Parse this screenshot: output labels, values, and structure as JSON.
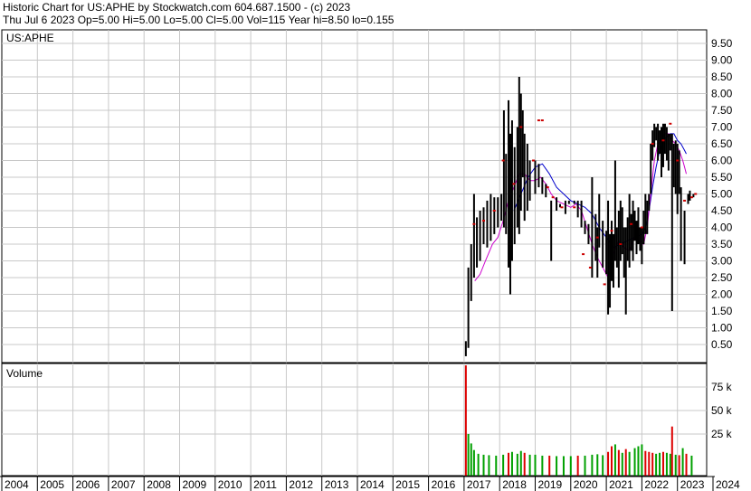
{
  "header": {
    "line1": "Historic Chart for US:APHE by Stockwatch.com 604.687.1500 - (c) 2023",
    "line2": "Thu Jul  6 2023   Op=5.00  Hi=5.00  Lo=5.00  Cl=5.00  Vol=115   Year hi=8.50   lo=0.155"
  },
  "colors": {
    "background": "#ffffff",
    "grid": "#c8c8c8",
    "price_bars": "#000000",
    "price_marks": "#cc0000",
    "ma_short": "#cc00cc",
    "ma_long": "#0000cc",
    "volume_green": "#00a000",
    "volume_red": "#dd0000"
  },
  "chart_data": [
    {
      "type": "ohlc",
      "title": "US:APHE",
      "x_range": [
        2004,
        2024
      ],
      "ylim": [
        0,
        10
      ],
      "y_ticks": [
        "9.50",
        "9.00",
        "8.50",
        "8.00",
        "7.50",
        "7.00",
        "6.50",
        "6.00",
        "5.50",
        "5.00",
        "4.50",
        "4.00",
        "3.50",
        "3.00",
        "2.50",
        "2.00",
        "1.50",
        "1.00",
        "0.50"
      ],
      "y_tick_values": [
        9.5,
        9.0,
        8.5,
        8.0,
        7.5,
        7.0,
        6.5,
        6.0,
        5.5,
        5.0,
        4.5,
        4.0,
        3.5,
        3.0,
        2.5,
        2.0,
        1.5,
        1.0,
        0.5
      ],
      "grid": true,
      "price_range_bars": [
        [
          2017.05,
          0.15,
          0.6
        ],
        [
          2017.12,
          0.4,
          2.8
        ],
        [
          2017.2,
          1.8,
          3.5
        ],
        [
          2017.28,
          2.5,
          5.0
        ],
        [
          2017.36,
          2.8,
          4.3
        ],
        [
          2017.45,
          3.0,
          4.5
        ],
        [
          2017.55,
          3.5,
          4.6
        ],
        [
          2017.65,
          3.4,
          4.8
        ],
        [
          2017.75,
          3.6,
          5.0
        ],
        [
          2017.85,
          3.8,
          4.9
        ],
        [
          2017.95,
          4.0,
          4.9
        ],
        [
          2018.05,
          4.2,
          5.0
        ],
        [
          2018.12,
          4.0,
          7.5
        ],
        [
          2018.18,
          3.8,
          6.2
        ],
        [
          2018.25,
          2.8,
          7.8
        ],
        [
          2018.3,
          2.0,
          6.8
        ],
        [
          2018.35,
          3.0,
          7.2
        ],
        [
          2018.42,
          3.5,
          6.4
        ],
        [
          2018.5,
          4.0,
          7.0
        ],
        [
          2018.55,
          3.8,
          8.5
        ],
        [
          2018.6,
          4.5,
          8.0
        ],
        [
          2018.65,
          5.5,
          7.5
        ],
        [
          2018.7,
          4.2,
          6.8
        ],
        [
          2018.78,
          4.5,
          6.5
        ],
        [
          2018.85,
          4.8,
          6.0
        ],
        [
          2019.0,
          5.0,
          6.0
        ],
        [
          2019.1,
          5.2,
          5.9
        ],
        [
          2019.2,
          5.0,
          5.5
        ],
        [
          2019.3,
          4.9,
          5.3
        ],
        [
          2019.45,
          3.0,
          4.8
        ],
        [
          2019.6,
          4.5,
          4.9
        ],
        [
          2019.7,
          4.6,
          4.7
        ],
        [
          2019.85,
          4.4,
          4.8
        ],
        [
          2019.95,
          4.7,
          4.8
        ],
        [
          2020.1,
          4.7,
          4.8
        ],
        [
          2020.2,
          4.3,
          4.8
        ],
        [
          2020.3,
          4.0,
          4.8
        ],
        [
          2020.4,
          3.8,
          4.2
        ],
        [
          2020.5,
          3.5,
          4.1
        ],
        [
          2020.6,
          2.5,
          5.5
        ],
        [
          2020.7,
          3.0,
          4.4
        ],
        [
          2020.75,
          2.5,
          4.0
        ],
        [
          2020.8,
          3.4,
          5.0
        ],
        [
          2020.9,
          2.8,
          4.2
        ],
        [
          2021.0,
          2.6,
          3.9
        ],
        [
          2021.05,
          1.4,
          4.8
        ],
        [
          2021.1,
          1.6,
          3.8
        ],
        [
          2021.15,
          2.4,
          4.2
        ],
        [
          2021.2,
          2.2,
          3.8
        ],
        [
          2021.25,
          3.0,
          6.0
        ],
        [
          2021.3,
          2.8,
          4.0
        ],
        [
          2021.35,
          2.2,
          4.5
        ],
        [
          2021.4,
          3.0,
          4.8
        ],
        [
          2021.45,
          3.2,
          4.6
        ],
        [
          2021.5,
          2.5,
          4.0
        ],
        [
          2021.55,
          1.4,
          4.0
        ],
        [
          2021.6,
          3.0,
          4.3
        ],
        [
          2021.65,
          2.8,
          5.0
        ],
        [
          2021.7,
          3.3,
          4.4
        ],
        [
          2021.75,
          3.0,
          4.8
        ],
        [
          2021.8,
          3.6,
          4.5
        ],
        [
          2021.85,
          3.2,
          4.2
        ],
        [
          2021.9,
          3.5,
          4.6
        ],
        [
          2021.95,
          3.3,
          4.0
        ],
        [
          2022.0,
          2.9,
          4.0
        ],
        [
          2022.05,
          3.5,
          4.5
        ],
        [
          2022.1,
          3.8,
          5.0
        ],
        [
          2022.15,
          3.8,
          4.8
        ],
        [
          2022.2,
          4.5,
          5.0
        ],
        [
          2022.25,
          5.0,
          6.5
        ],
        [
          2022.3,
          6.0,
          6.9
        ],
        [
          2022.35,
          6.4,
          7.1
        ],
        [
          2022.4,
          6.6,
          7.0
        ],
        [
          2022.45,
          6.0,
          7.1
        ],
        [
          2022.5,
          6.2,
          6.9
        ],
        [
          2022.55,
          5.5,
          7.0
        ],
        [
          2022.6,
          5.8,
          7.1
        ],
        [
          2022.65,
          6.2,
          7.1
        ],
        [
          2022.7,
          6.0,
          7.0
        ],
        [
          2022.75,
          5.7,
          6.8
        ],
        [
          2022.8,
          6.3,
          6.8
        ],
        [
          2022.85,
          1.5,
          6.8
        ],
        [
          2022.9,
          5.2,
          6.5
        ],
        [
          2022.95,
          5.0,
          6.6
        ],
        [
          2023.0,
          4.4,
          6.5
        ],
        [
          2023.05,
          5.0,
          6.3
        ],
        [
          2023.1,
          3.0,
          5.2
        ],
        [
          2023.2,
          2.9,
          4.5
        ],
        [
          2023.3,
          4.7,
          5.0
        ],
        [
          2023.35,
          4.8,
          5.1
        ],
        [
          2023.45,
          4.9,
          5.0
        ],
        [
          2023.51,
          5.0,
          5.0
        ]
      ],
      "close_marks": [
        [
          2017.28,
          4.1
        ],
        [
          2017.55,
          4.2
        ],
        [
          2017.85,
          4.5
        ],
        [
          2018.1,
          6.0
        ],
        [
          2018.4,
          5.3
        ],
        [
          2018.6,
          7.0
        ],
        [
          2018.95,
          6.0
        ],
        [
          2019.1,
          7.2
        ],
        [
          2019.2,
          7.2
        ],
        [
          2019.35,
          5.2
        ],
        [
          2019.5,
          4.9
        ],
        [
          2019.75,
          4.6
        ],
        [
          2020.1,
          4.6
        ],
        [
          2020.35,
          3.2
        ],
        [
          2020.55,
          2.8
        ],
        [
          2020.75,
          3.7
        ],
        [
          2020.95,
          2.3
        ],
        [
          2021.15,
          3.9
        ],
        [
          2021.4,
          3.5
        ],
        [
          2021.7,
          4.1
        ],
        [
          2022.0,
          4.0
        ],
        [
          2022.3,
          6.5
        ],
        [
          2022.6,
          6.6
        ],
        [
          2022.8,
          7.1
        ],
        [
          2023.0,
          6.0
        ],
        [
          2023.2,
          4.8
        ],
        [
          2023.4,
          4.9
        ],
        [
          2023.51,
          5.0
        ]
      ],
      "ma_short": [
        [
          2017.3,
          2.4
        ],
        [
          2017.45,
          2.6
        ],
        [
          2017.6,
          3.0
        ],
        [
          2017.8,
          3.5
        ],
        [
          2017.95,
          3.7
        ],
        [
          2018.1,
          4.2
        ],
        [
          2018.25,
          4.8
        ],
        [
          2018.4,
          5.2
        ],
        [
          2018.55,
          5.6
        ],
        [
          2018.7,
          5.6
        ],
        [
          2018.85,
          5.4
        ],
        [
          2019.0,
          5.4
        ],
        [
          2019.15,
          5.5
        ],
        [
          2019.3,
          5.3
        ],
        [
          2019.45,
          5.0
        ],
        [
          2019.6,
          4.8
        ],
        [
          2019.8,
          4.7
        ],
        [
          2020.0,
          4.6
        ],
        [
          2020.15,
          4.7
        ],
        [
          2020.3,
          4.5
        ],
        [
          2020.45,
          4.0
        ],
        [
          2020.6,
          3.5
        ],
        [
          2020.75,
          3.1
        ],
        [
          2020.9,
          2.8
        ],
        [
          2021.05,
          2.5
        ],
        [
          2021.2,
          3.2
        ],
        [
          2021.35,
          3.6
        ],
        [
          2021.5,
          3.4
        ],
        [
          2021.65,
          3.3
        ],
        [
          2021.8,
          3.7
        ],
        [
          2021.95,
          3.6
        ],
        [
          2022.05,
          3.5
        ],
        [
          2022.15,
          4.0
        ],
        [
          2022.25,
          5.0
        ],
        [
          2022.35,
          6.0
        ],
        [
          2022.45,
          6.5
        ],
        [
          2022.55,
          6.6
        ],
        [
          2022.65,
          6.8
        ],
        [
          2022.75,
          6.8
        ],
        [
          2022.85,
          6.6
        ],
        [
          2022.95,
          6.5
        ],
        [
          2023.05,
          6.3
        ],
        [
          2023.15,
          6.0
        ],
        [
          2023.2,
          5.8
        ],
        [
          2023.25,
          5.6
        ]
      ],
      "ma_long": [
        [
          2018.4,
          4.5
        ],
        [
          2018.6,
          5.0
        ],
        [
          2018.8,
          5.5
        ],
        [
          2019.0,
          5.8
        ],
        [
          2019.2,
          5.9
        ],
        [
          2019.4,
          5.6
        ],
        [
          2019.6,
          5.2
        ],
        [
          2019.8,
          5.0
        ],
        [
          2020.0,
          4.8
        ],
        [
          2020.2,
          4.7
        ],
        [
          2020.4,
          4.6
        ],
        [
          2020.6,
          4.4
        ],
        [
          2020.8,
          4.0
        ],
        [
          2021.0,
          3.7
        ],
        [
          2021.2,
          3.4
        ],
        [
          2021.4,
          3.5
        ],
        [
          2021.6,
          3.6
        ],
        [
          2021.8,
          3.7
        ],
        [
          2022.0,
          3.8
        ],
        [
          2022.1,
          4.0
        ],
        [
          2022.2,
          4.5
        ],
        [
          2022.3,
          5.2
        ],
        [
          2022.4,
          5.8
        ],
        [
          2022.5,
          6.3
        ],
        [
          2022.6,
          6.6
        ],
        [
          2022.7,
          6.7
        ],
        [
          2022.8,
          6.8
        ],
        [
          2022.9,
          6.8
        ],
        [
          2023.0,
          6.6
        ],
        [
          2023.1,
          6.5
        ],
        [
          2023.2,
          6.3
        ],
        [
          2023.25,
          6.2
        ]
      ]
    },
    {
      "type": "bar",
      "title": "Volume",
      "x_range": [
        2004,
        2024
      ],
      "ylim": [
        0,
        100000
      ],
      "y_ticks": [
        "75 k",
        "50 k",
        "25 k"
      ],
      "y_tick_values": [
        75000,
        50000,
        25000
      ],
      "grid": true,
      "bars": [
        [
          2017.05,
          98000,
          "red"
        ],
        [
          2017.12,
          25000,
          "green"
        ],
        [
          2017.2,
          15000,
          "green"
        ],
        [
          2017.28,
          8000,
          "green"
        ],
        [
          2017.4,
          4000,
          "green"
        ],
        [
          2017.55,
          3000,
          "green"
        ],
        [
          2017.7,
          2500,
          "green"
        ],
        [
          2017.9,
          2000,
          "green"
        ],
        [
          2018.1,
          3000,
          "green"
        ],
        [
          2018.25,
          5000,
          "red"
        ],
        [
          2018.35,
          6000,
          "green"
        ],
        [
          2018.5,
          4000,
          "green"
        ],
        [
          2018.6,
          7000,
          "green"
        ],
        [
          2018.7,
          5000,
          "red"
        ],
        [
          2018.85,
          3000,
          "green"
        ],
        [
          2019.0,
          3000,
          "green"
        ],
        [
          2019.2,
          2000,
          "green"
        ],
        [
          2019.4,
          2000,
          "red"
        ],
        [
          2019.6,
          1500,
          "green"
        ],
        [
          2019.8,
          1500,
          "green"
        ],
        [
          2020.0,
          1500,
          "green"
        ],
        [
          2020.2,
          2000,
          "red"
        ],
        [
          2020.4,
          2000,
          "green"
        ],
        [
          2020.6,
          3000,
          "green"
        ],
        [
          2020.75,
          3500,
          "green"
        ],
        [
          2020.9,
          2500,
          "green"
        ],
        [
          2021.05,
          6000,
          "red"
        ],
        [
          2021.15,
          12000,
          "red"
        ],
        [
          2021.25,
          14000,
          "green"
        ],
        [
          2021.35,
          8000,
          "red"
        ],
        [
          2021.45,
          5000,
          "green"
        ],
        [
          2021.55,
          9000,
          "red"
        ],
        [
          2021.65,
          6000,
          "green"
        ],
        [
          2021.8,
          10000,
          "green"
        ],
        [
          2021.9,
          12000,
          "green"
        ],
        [
          2022.0,
          14000,
          "green"
        ],
        [
          2022.1,
          7000,
          "red"
        ],
        [
          2022.2,
          6000,
          "red"
        ],
        [
          2022.3,
          5000,
          "red"
        ],
        [
          2022.4,
          4000,
          "green"
        ],
        [
          2022.5,
          5000,
          "green"
        ],
        [
          2022.6,
          6000,
          "red"
        ],
        [
          2022.7,
          5000,
          "green"
        ],
        [
          2022.8,
          4000,
          "green"
        ],
        [
          2022.85,
          33000,
          "red"
        ],
        [
          2022.95,
          3000,
          "green"
        ],
        [
          2023.05,
          2500,
          "red"
        ],
        [
          2023.15,
          10000,
          "green"
        ],
        [
          2023.25,
          4000,
          "red"
        ],
        [
          2023.4,
          2000,
          "green"
        ]
      ]
    }
  ],
  "x_axis": {
    "labels": [
      "2004",
      "2005",
      "2006",
      "2007",
      "2008",
      "2009",
      "2010",
      "2011",
      "2012",
      "2013",
      "2014",
      "2015",
      "2016",
      "2017",
      "2018",
      "2019",
      "2020",
      "2021",
      "2022",
      "2023",
      "2024"
    ],
    "values": [
      2004,
      2005,
      2006,
      2007,
      2008,
      2009,
      2010,
      2011,
      2012,
      2013,
      2014,
      2015,
      2016,
      2017,
      2018,
      2019,
      2020,
      2021,
      2022,
      2023,
      2024
    ]
  }
}
